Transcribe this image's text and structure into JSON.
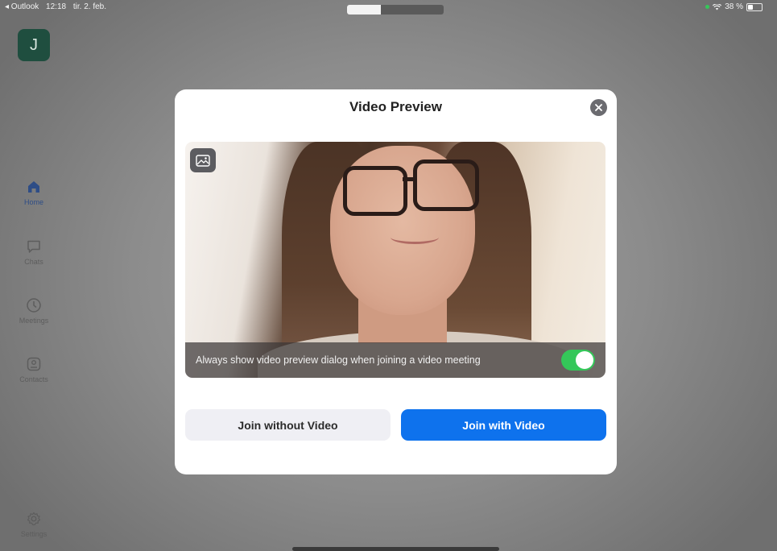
{
  "status_bar": {
    "back_app": "◂ Outlook",
    "time": "12:18",
    "date": "tir. 2. feb.",
    "battery_text": "38 %",
    "battery_level": 0.38
  },
  "sidebar": {
    "avatar_initial": "J",
    "items": [
      {
        "label": "Home",
        "icon": "home-icon"
      },
      {
        "label": "Chats",
        "icon": "chat-bubble-icon"
      },
      {
        "label": "Meetings",
        "icon": "clock-icon"
      },
      {
        "label": "Contacts",
        "icon": "contact-card-icon"
      },
      {
        "label": "Settings",
        "icon": "gear-icon"
      }
    ],
    "active_index": 0
  },
  "modal": {
    "title": "Video Preview",
    "always_show_label": "Always show video preview dialog when joining a video meeting",
    "always_show_enabled": true,
    "join_without_video": "Join without Video",
    "join_with_video": "Join with Video"
  },
  "colors": {
    "accent": "#0e72ed",
    "toggle_on": "#34c759",
    "avatar_bg": "#1f4e3f",
    "active_nav": "#2e4d86"
  }
}
